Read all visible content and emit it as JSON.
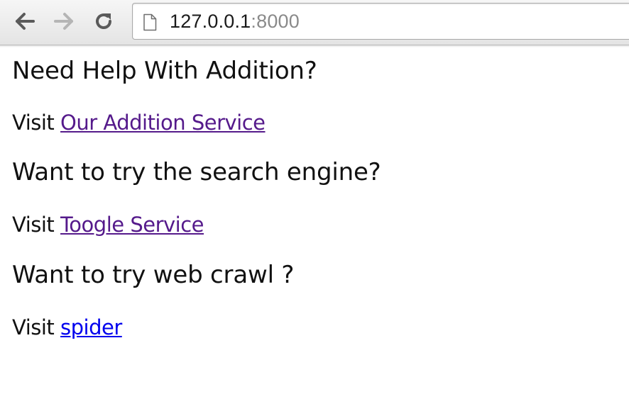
{
  "browser": {
    "url_host": "127.0.0.1",
    "url_port": ":8000",
    "back_icon": "arrow-left-icon",
    "forward_icon": "arrow-right-icon",
    "reload_icon": "reload-icon",
    "page_icon": "page-icon"
  },
  "sections": [
    {
      "heading": "Need Help With Addition?",
      "prefix": "Visit ",
      "link_text": "Our Addition Service",
      "link_state": "visited"
    },
    {
      "heading": "Want to try the search engine?",
      "prefix": "Visit ",
      "link_text": "Toogle Service",
      "link_state": "visited"
    },
    {
      "heading": "Want to try web crawl ?",
      "prefix": "Visit ",
      "link_text": "spider",
      "link_state": "unvisited"
    }
  ],
  "colors": {
    "visited_link": "#551a8b",
    "unvisited_link": "#0000ee",
    "url_port": "#8a8a8a"
  }
}
